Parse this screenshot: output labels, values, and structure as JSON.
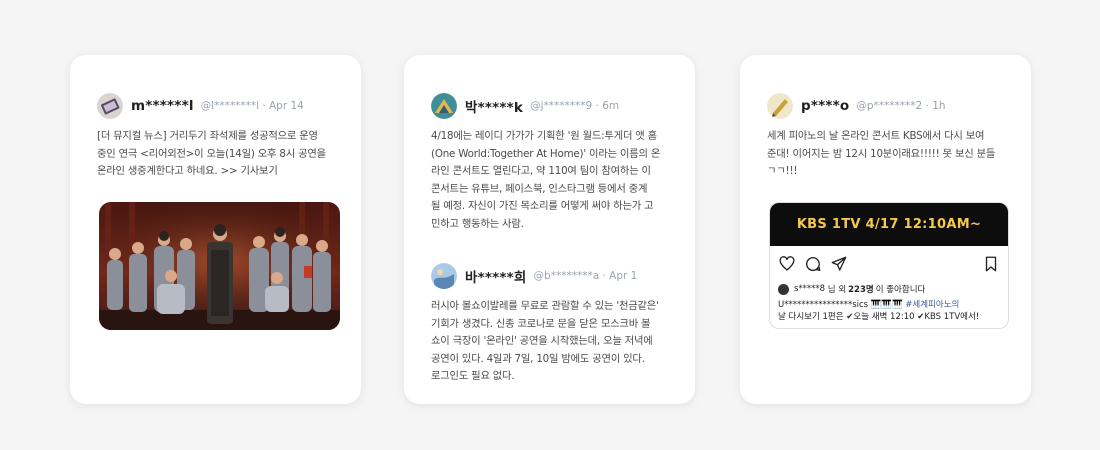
{
  "posts": [
    {
      "username": "m******l",
      "meta": "@l********l · Apr 14",
      "text": "[더 뮤지컬 뉴스] 거리두기 좌석제를 성공적으로 운영\n중인 연극 <리어외전>이 오늘(14일) 오후 8시 공연을\n온라인 생중계한다고 하네요. >> 기사보기"
    },
    {
      "username": "박*****k",
      "meta": "@j********9 · 6m",
      "text": "4/18에는 레이디 가가가 기획한 '원 월드:투게더 앳 홈\n(One World:Together At Home)' 이라는 이름의 온\n라인 콘서트도 열린다고, 약 110여 팀이 참여하는 이\n콘서트는 유튜브, 페이스북, 인스타그램 등에서 중계\n될 예정. 자신이 가진 목소리를 어떻게 써야 하는가 고\n민하고 행동하는 사람."
    },
    {
      "username": "바*****희",
      "meta": "@b********a · Apr 1",
      "text": "러시아 볼쇼이발레를 무료로 관람할 수 있는 '천금같은'\n기회가 생겼다. 신종 코로나로 문을 닫은 모스크바 볼\n쇼이 극장이 '온라인' 공연을 시작했는데, 오늘 저녁에\n공연이 있다. 4일과 7일, 10일 밤에도 공연이 있다.\n로그인도 필요 없다."
    },
    {
      "username": "p****o",
      "meta": "@p********2 · 1h",
      "text": "세계 피아노의 날 온라인 콘서트 KBS에서 다시 보여\n준대! 이어지는 밤 12시 10분이래요!!!!! 못 보신 분들\nㄱㄱ!!!"
    }
  ],
  "instagram": {
    "banner": "KBS 1TV 4/17 12:10AM~",
    "likes_user": "s*****8",
    "likes_mid": "님 외",
    "likes_count": "223명",
    "likes_tail": "이 좋아합니다",
    "caption_user": "U****************sics",
    "caption_emoji": "🎹🎹🎹",
    "caption_tag": "#세계피아노의",
    "caption_line2": "날 다시보기 1편은 ✔오늘 새벽 12:10 ✔KBS 1TV에서!"
  },
  "colors": {
    "background": "#f5f5f6",
    "card": "#ffffff",
    "meta": "#9aa3ad",
    "banner_bg": "#0d0d0d",
    "banner_text": "#f6c94a"
  }
}
